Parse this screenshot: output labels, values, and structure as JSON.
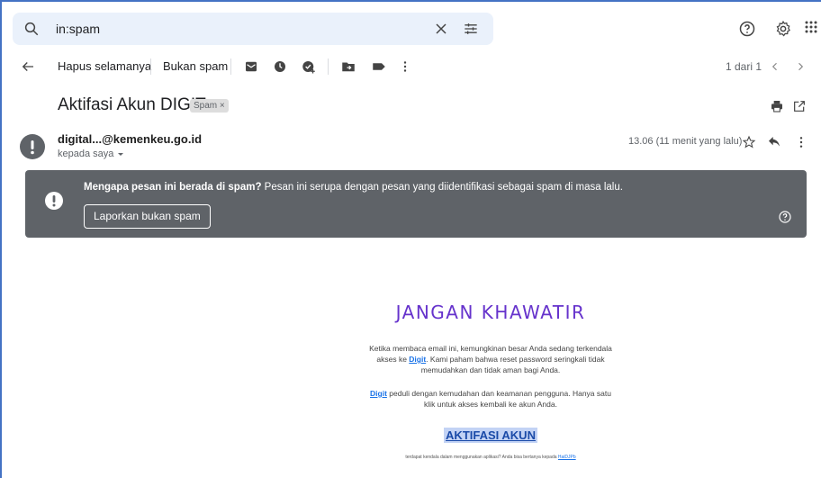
{
  "search": {
    "query": "in:spam"
  },
  "toolbar": {
    "delete_forever": "Hapus selamanya",
    "not_spam": "Bukan spam",
    "pager": "1 dari 1"
  },
  "email": {
    "subject": "Aktifasi Akun DIGIT",
    "label_chip": "Spam ×",
    "sender": "digital...@kemenkeu.go.id",
    "recipient": "kepada saya",
    "timestamp": "13.06 (11 menit yang lalu)"
  },
  "spam_banner": {
    "title": "Mengapa pesan ini berada di spam?",
    "description": " Pesan ini serupa dengan pesan yang diidentifikasi sebagai spam di masa lalu.",
    "report_button": "Laporkan bukan spam"
  },
  "message": {
    "headline": "JANGAN KHAWATIR",
    "p1_before": "Ketika membaca email ini, kemungkinan besar Anda sedang terkendala akses ke ",
    "p1_link": "Digit",
    "p1_after": ". Kami paham bahwa reset password seringkali tidak memudahkan dan tidak aman bagi Anda.",
    "p2_link": "Digit",
    "p2_after": " peduli dengan kemudahan dan keamanan pengguna. Hanya satu klik untuk akses kembali ke akun Anda.",
    "cta": "AKTIFASI AKUN",
    "footer_before": "terdapat kendala dalam menggunakan aplikasi? Anda bisa bertanya kepada ",
    "footer_link": "HaiDJPb"
  },
  "colors": {
    "accent_blue": "#1a73e8",
    "banner_bg": "#5f6368",
    "headline_purple": "#6633cc",
    "search_bg": "#eaf1fb"
  },
  "icons": [
    "search-icon",
    "clear-icon",
    "filter-icon",
    "help-icon",
    "settings-icon",
    "apps-icon",
    "back-icon",
    "report-spam-icon",
    "snooze-icon",
    "add-task-icon",
    "move-to-icon",
    "label-icon",
    "more-vert-icon",
    "prev-icon",
    "next-icon",
    "print-icon",
    "open-new-window-icon",
    "star-icon",
    "reply-icon",
    "warning-icon"
  ]
}
